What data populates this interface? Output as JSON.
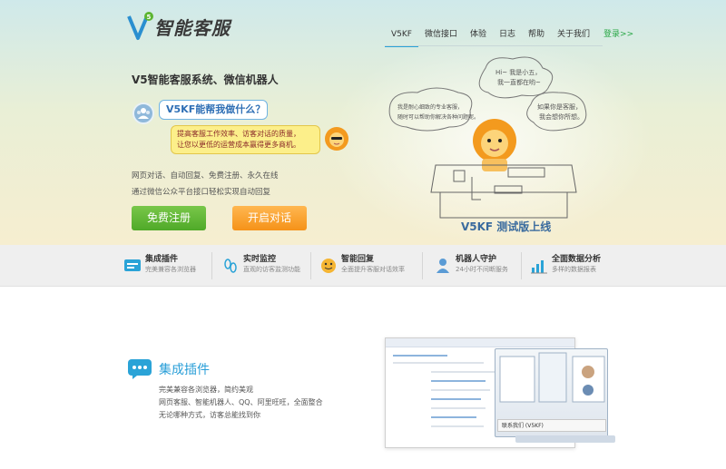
{
  "header": {
    "logo_text": "智能客服",
    "nav": [
      {
        "label": "V5KF",
        "active": true
      },
      {
        "label": "微信接口",
        "active": false
      },
      {
        "label": "体验",
        "active": false
      },
      {
        "label": "日志",
        "active": false
      },
      {
        "label": "帮助",
        "active": false
      },
      {
        "label": "关于我们",
        "active": false
      }
    ],
    "login": "登录>>"
  },
  "hero": {
    "headline": "V5智能客服系统、微信机器人",
    "question": "V5KF能帮我做什么？",
    "answer_line1": "提高客服工作效率、访客对话的质量，",
    "answer_line2": "让您以更低的运营成本赢得更多商机。",
    "desc_line1": "网页对话、自动回复、免费注册、永久在线",
    "desc_line2": "通过微信公众平台接口轻松实现自动回复",
    "register_button": "免费注册",
    "chat_button": "开启对话",
    "beta_label": "V5KF 测试版上线",
    "speech_top": "Hi~ 我是小五，",
    "speech_top2": "我一直都在哟~",
    "speech_left1": "我是耐心细致的专业客服，",
    "speech_left2": "随时可以帮助你解决各种问题呢。",
    "speech_right1": "如果你是客服，",
    "speech_right2": "我会想你所想。"
  },
  "features": [
    {
      "title": "集成插件",
      "subtitle": "完美兼容各浏览器",
      "icon": "chat-plugin-icon"
    },
    {
      "title": "实时监控",
      "subtitle": "直观的访客监测功能",
      "icon": "footprint-icon"
    },
    {
      "title": "智能回复",
      "subtitle": "全面提升客服对话效率",
      "icon": "smiley-chat-icon"
    },
    {
      "title": "机器人守护",
      "subtitle": "24小时不间断服务",
      "icon": "robot-icon"
    },
    {
      "title": "全面数据分析",
      "subtitle": "多样的数据报表",
      "icon": "bar-chart-icon"
    }
  ],
  "plugin_section": {
    "title": "集成插件",
    "line1": "完美兼容各浏览器，简约美观",
    "line2": "网页客服、智能机器人、QQ、阿里旺旺，全面整合",
    "line3": "无论哪种方式，访客总能找到你",
    "widget_label": "联系我们 (V5KF)"
  },
  "colors": {
    "accent": "#2aa3d7",
    "register": "#5cb531",
    "chat": "#f7a030"
  }
}
